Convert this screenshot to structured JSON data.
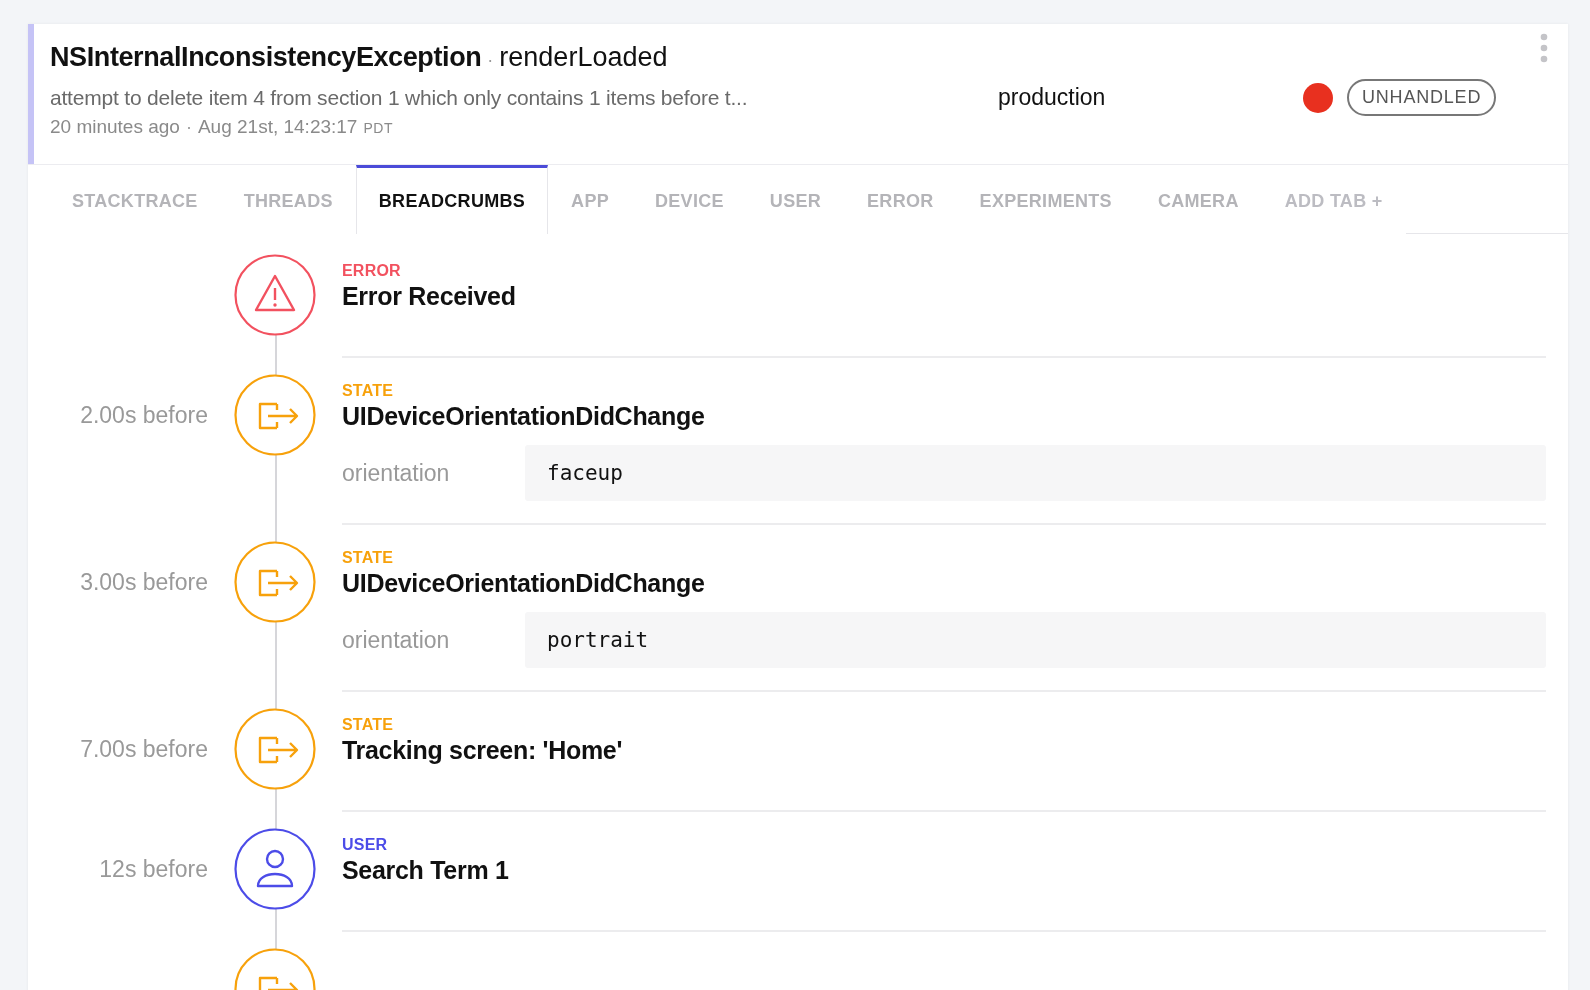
{
  "header": {
    "title": "NSInternalInconsistencyException",
    "title_separator": "·",
    "context": "renderLoaded",
    "message": "attempt to delete item 4 from section 1 which only contains 1 items before t...",
    "relative_time": "20 minutes ago",
    "time_separator": "·",
    "timestamp": "Aug 21st, 14:23:17",
    "timezone": "PDT",
    "environment": "production",
    "handled_badge": "UNHANDLED"
  },
  "tabs": [
    {
      "label": "STACKTRACE",
      "selected": false,
      "kind": "tab"
    },
    {
      "label": "THREADS",
      "selected": false,
      "kind": "tab"
    },
    {
      "label": "BREADCRUMBS",
      "selected": true,
      "kind": "tab"
    },
    {
      "label": "APP",
      "selected": false,
      "kind": "tab"
    },
    {
      "label": "DEVICE",
      "selected": false,
      "kind": "tab"
    },
    {
      "label": "USER",
      "selected": false,
      "kind": "tab"
    },
    {
      "label": "ERROR",
      "selected": false,
      "kind": "tab"
    },
    {
      "label": "EXPERIMENTS",
      "selected": false,
      "kind": "tab"
    },
    {
      "label": "CAMERA",
      "selected": false,
      "kind": "tab"
    },
    {
      "label": "ADD TAB +",
      "selected": false,
      "kind": "add"
    }
  ],
  "breadcrumbs": [
    {
      "kind": "error",
      "type": "ERROR",
      "title": "Error Received"
    },
    {
      "kind": "state",
      "time": "2.00s before",
      "type": "STATE",
      "title": "UIDeviceOrientationDidChange",
      "details": [
        {
          "key": "orientation",
          "value": "faceup"
        }
      ]
    },
    {
      "kind": "state",
      "time": "3.00s before",
      "type": "STATE",
      "title": "UIDeviceOrientationDidChange",
      "details": [
        {
          "key": "orientation",
          "value": "portrait"
        }
      ]
    },
    {
      "kind": "state",
      "time": "7.00s before",
      "type": "STATE",
      "title": "Tracking screen: 'Home'"
    },
    {
      "kind": "user",
      "time": "12s before",
      "type": "USER",
      "title": "Search Term 1"
    },
    {
      "kind": "state"
    }
  ]
}
